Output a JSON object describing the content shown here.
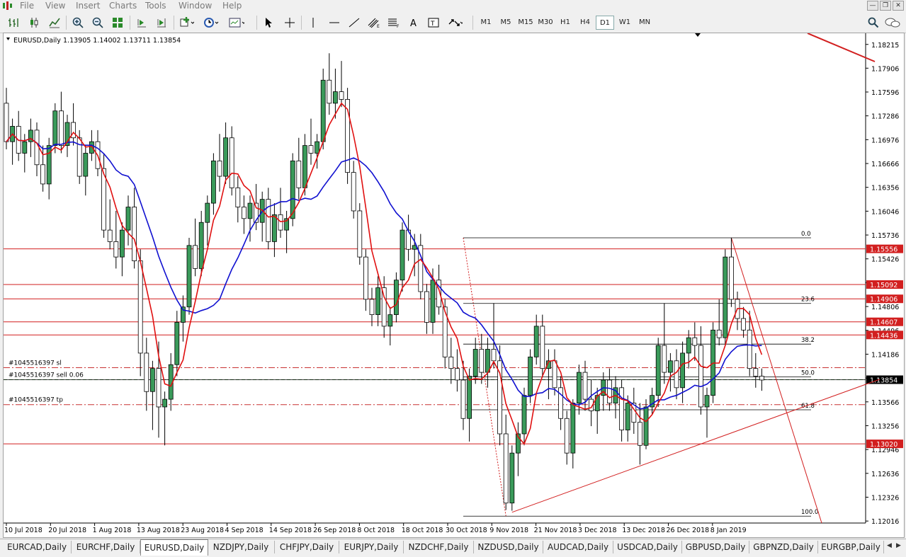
{
  "menu": [
    "File",
    "View",
    "Insert",
    "Charts",
    "Tools",
    "Window",
    "Help"
  ],
  "toolbar": {
    "timeframes": [
      "M1",
      "M5",
      "M15",
      "M30",
      "H1",
      "H4",
      "D1",
      "W1",
      "MN"
    ],
    "active_timeframe": "D1"
  },
  "chart_info": {
    "symbol_label": "EURUSD,Daily",
    "ohlc": "1.13905 1.14002 1.13711 1.13854"
  },
  "price_axis": [
    "1.18215",
    "1.17906",
    "1.17596",
    "1.17286",
    "1.16976",
    "1.16666",
    "1.16356",
    "1.16046",
    "1.15736",
    "1.15426",
    "1.15116",
    "1.14806",
    "1.14496",
    "1.14186",
    "1.13876",
    "1.13566",
    "1.13256",
    "1.12946",
    "1.12636",
    "1.12326",
    "1.12016"
  ],
  "price_range": [
    1.1199,
    1.1836
  ],
  "date_axis": [
    "10 Jul 2018",
    "20 Jul 2018",
    "1 Aug 2018",
    "13 Aug 2018",
    "23 Aug 2018",
    "4 Sep 2018",
    "14 Sep 2018",
    "26 Sep 2018",
    "8 Oct 2018",
    "18 Oct 2018",
    "30 Oct 2018",
    "9 Nov 2018",
    "21 Nov 2018",
    "3 Dec 2018",
    "13 Dec 2018",
    "26 Dec 2018",
    "8 Jan 2019"
  ],
  "levels": [
    {
      "price": 1.15556,
      "label": "1.15556",
      "color": "#d21f1f"
    },
    {
      "price": 1.15092,
      "label": "1.15092",
      "color": "#d21f1f"
    },
    {
      "price": 1.14906,
      "label": "1.14906",
      "color": "#d21f1f"
    },
    {
      "price": 1.14607,
      "label": "1.14607",
      "color": "#d21f1f"
    },
    {
      "price": 1.14436,
      "label": "1.14436",
      "color": "#d21f1f"
    },
    {
      "price": 1.1302,
      "label": "1.13020",
      "color": "#d21f1f"
    }
  ],
  "current_price": {
    "price": 1.13854,
    "label": "1.13854"
  },
  "order_lines": [
    {
      "label": "#1045516397 sl",
      "price": 1.1401,
      "color": "#c83232",
      "style": "dashdot"
    },
    {
      "label": "#1045516397 sell 0.06",
      "price": 1.13854,
      "color": "#2e8b2e",
      "style": "dash"
    },
    {
      "label": "#1045516397 tp",
      "price": 1.1353,
      "color": "#c83232",
      "style": "dashdot"
    }
  ],
  "fibonacci": [
    {
      "label": "0.0",
      "price": 1.157
    },
    {
      "label": "23.6",
      "price": 1.14846
    },
    {
      "label": "38.2",
      "price": 1.14317
    },
    {
      "label": "50.0",
      "price": 1.1389
    },
    {
      "label": "61.8",
      "price": 1.13463
    },
    {
      "label": "100.0",
      "price": 1.1208
    }
  ],
  "colors": {
    "bull": "#3a9a5a",
    "bear": "#ffffff",
    "fast_ma": "#e01010",
    "slow_ma": "#1010d0",
    "trend": "#d21f1f"
  },
  "tabs": [
    "EURCAD,Daily",
    "EURCHF,Daily",
    "EURUSD,Daily",
    "NZDJPY,Daily",
    "CHFJPY,Daily",
    "EURJPY,Daily",
    "NZDCHF,Daily",
    "NZDUSD,Daily",
    "AUDCAD,Daily",
    "USDCAD,Daily",
    "GBPUSD,Daily",
    "GBPNZD,Daily",
    "EURGBP,Daily"
  ],
  "active_tab": "EURUSD,Daily",
  "chart_data": {
    "type": "candlestick",
    "title": "EURUSD,Daily",
    "ylim": [
      1.1199,
      1.1836
    ],
    "series": [
      {
        "name": "price",
        "points": [
          [
            0,
            1.1745,
            1.1765,
            1.1685,
            1.1695
          ],
          [
            1,
            1.1695,
            1.1725,
            1.1665,
            1.1715
          ],
          [
            2,
            1.1715,
            1.1735,
            1.167,
            1.168
          ],
          [
            3,
            1.168,
            1.1705,
            1.1655,
            1.1695
          ],
          [
            4,
            1.1695,
            1.1725,
            1.1675,
            1.171
          ],
          [
            5,
            1.171,
            1.172,
            1.165,
            1.1665
          ],
          [
            6,
            1.1665,
            1.169,
            1.163,
            1.164
          ],
          [
            7,
            1.164,
            1.17,
            1.162,
            1.169
          ],
          [
            8,
            1.169,
            1.1745,
            1.168,
            1.1735
          ],
          [
            9,
            1.1735,
            1.176,
            1.168,
            1.169
          ],
          [
            10,
            1.169,
            1.173,
            1.1675,
            1.172
          ],
          [
            11,
            1.172,
            1.1745,
            1.169,
            1.17
          ],
          [
            12,
            1.17,
            1.171,
            1.164,
            1.165
          ],
          [
            13,
            1.165,
            1.169,
            1.1625,
            1.168
          ],
          [
            14,
            1.168,
            1.171,
            1.167,
            1.1695
          ],
          [
            15,
            1.1695,
            1.171,
            1.165,
            1.166
          ],
          [
            16,
            1.166,
            1.168,
            1.157,
            1.158
          ],
          [
            17,
            1.158,
            1.162,
            1.1555,
            1.1565
          ],
          [
            18,
            1.1565,
            1.1605,
            1.153,
            1.1545
          ],
          [
            19,
            1.1545,
            1.159,
            1.152,
            1.158
          ],
          [
            20,
            1.158,
            1.1625,
            1.156,
            1.161
          ],
          [
            21,
            1.161,
            1.1635,
            1.153,
            1.154
          ],
          [
            22,
            1.154,
            1.1555,
            1.139,
            1.142
          ],
          [
            23,
            1.142,
            1.144,
            1.1345,
            1.137
          ],
          [
            24,
            1.137,
            1.141,
            1.132,
            1.14
          ],
          [
            25,
            1.14,
            1.1435,
            1.131,
            1.135
          ],
          [
            26,
            1.135,
            1.137,
            1.13,
            1.136
          ],
          [
            27,
            1.136,
            1.142,
            1.1345,
            1.1405
          ],
          [
            28,
            1.1405,
            1.1475,
            1.139,
            1.146
          ],
          [
            29,
            1.146,
            1.1495,
            1.1435,
            1.148
          ],
          [
            30,
            1.148,
            1.157,
            1.147,
            1.156
          ],
          [
            31,
            1.156,
            1.1595,
            1.152,
            1.153
          ],
          [
            32,
            1.153,
            1.1605,
            1.152,
            1.159
          ],
          [
            33,
            1.159,
            1.1625,
            1.156,
            1.1615
          ],
          [
            34,
            1.1615,
            1.168,
            1.16,
            1.167
          ],
          [
            35,
            1.167,
            1.1705,
            1.163,
            1.165
          ],
          [
            36,
            1.165,
            1.172,
            1.164,
            1.17
          ],
          [
            37,
            1.17,
            1.1715,
            1.1625,
            1.1635
          ],
          [
            38,
            1.1635,
            1.165,
            1.159,
            1.161
          ],
          [
            39,
            1.161,
            1.1625,
            1.1575,
            1.1595
          ],
          [
            40,
            1.1595,
            1.1625,
            1.1565,
            1.1615
          ],
          [
            41,
            1.1615,
            1.164,
            1.158,
            1.159
          ],
          [
            42,
            1.159,
            1.163,
            1.1565,
            1.162
          ],
          [
            43,
            1.162,
            1.1635,
            1.1555,
            1.1565
          ],
          [
            44,
            1.1565,
            1.1615,
            1.1545,
            1.16
          ],
          [
            45,
            1.16,
            1.1635,
            1.157,
            1.158
          ],
          [
            46,
            1.158,
            1.1605,
            1.155,
            1.1595
          ],
          [
            47,
            1.1595,
            1.168,
            1.1585,
            1.167
          ],
          [
            48,
            1.167,
            1.17,
            1.162,
            1.1635
          ],
          [
            49,
            1.1635,
            1.1705,
            1.1625,
            1.169
          ],
          [
            50,
            1.169,
            1.1725,
            1.1665,
            1.168
          ],
          [
            51,
            1.168,
            1.1705,
            1.166,
            1.1695
          ],
          [
            52,
            1.1695,
            1.179,
            1.1685,
            1.1775
          ],
          [
            53,
            1.1775,
            1.181,
            1.173,
            1.1745
          ],
          [
            54,
            1.1745,
            1.179,
            1.1725,
            1.176
          ],
          [
            55,
            1.176,
            1.18,
            1.174,
            1.175
          ],
          [
            56,
            1.175,
            1.1765,
            1.164,
            1.1655
          ],
          [
            57,
            1.1655,
            1.167,
            1.1595,
            1.1605
          ],
          [
            58,
            1.1605,
            1.1615,
            1.1535,
            1.1545
          ],
          [
            59,
            1.1545,
            1.1555,
            1.1475,
            1.149
          ],
          [
            60,
            1.149,
            1.1505,
            1.1455,
            1.147
          ],
          [
            61,
            1.147,
            1.152,
            1.1455,
            1.1505
          ],
          [
            62,
            1.1505,
            1.152,
            1.144,
            1.1455
          ],
          [
            63,
            1.1455,
            1.148,
            1.143,
            1.147
          ],
          [
            64,
            1.147,
            1.1525,
            1.146,
            1.1515
          ],
          [
            65,
            1.1515,
            1.159,
            1.15,
            1.158
          ],
          [
            66,
            1.158,
            1.16,
            1.154,
            1.1555
          ],
          [
            67,
            1.1555,
            1.1575,
            1.152,
            1.156
          ],
          [
            68,
            1.156,
            1.1575,
            1.149,
            1.15
          ],
          [
            69,
            1.15,
            1.151,
            1.1445,
            1.146
          ],
          [
            70,
            1.146,
            1.153,
            1.1445,
            1.1515
          ],
          [
            71,
            1.1515,
            1.1535,
            1.147,
            1.148
          ],
          [
            72,
            1.148,
            1.149,
            1.14,
            1.1415
          ],
          [
            73,
            1.1415,
            1.144,
            1.138,
            1.14
          ],
          [
            74,
            1.14,
            1.1425,
            1.137,
            1.1385
          ],
          [
            75,
            1.1385,
            1.141,
            1.132,
            1.1335
          ],
          [
            76,
            1.1335,
            1.14,
            1.1305,
            1.139
          ],
          [
            77,
            1.139,
            1.144,
            1.138,
            1.1425
          ],
          [
            78,
            1.1425,
            1.1445,
            1.138,
            1.1395
          ],
          [
            79,
            1.1395,
            1.144,
            1.1375,
            1.1425
          ],
          [
            80,
            1.1425,
            1.1485,
            1.14,
            1.141
          ],
          [
            81,
            1.141,
            1.143,
            1.13,
            1.1315
          ],
          [
            82,
            1.1315,
            1.134,
            1.1216,
            1.1225
          ],
          [
            83,
            1.1225,
            1.13,
            1.1215,
            1.129
          ],
          [
            84,
            1.129,
            1.133,
            1.126,
            1.1315
          ],
          [
            85,
            1.1315,
            1.1375,
            1.13,
            1.1365
          ],
          [
            86,
            1.1365,
            1.1425,
            1.1355,
            1.1415
          ],
          [
            87,
            1.1415,
            1.147,
            1.1405,
            1.1455
          ],
          [
            88,
            1.1455,
            1.147,
            1.139,
            1.14
          ],
          [
            89,
            1.14,
            1.1425,
            1.136,
            1.141
          ],
          [
            90,
            1.141,
            1.1425,
            1.1365,
            1.1375
          ],
          [
            91,
            1.1375,
            1.139,
            1.132,
            1.1335
          ],
          [
            92,
            1.1335,
            1.1345,
            1.1275,
            1.129
          ],
          [
            93,
            1.129,
            1.136,
            1.127,
            1.1355
          ],
          [
            94,
            1.1355,
            1.1405,
            1.134,
            1.1395
          ],
          [
            95,
            1.1395,
            1.141,
            1.1345,
            1.136
          ],
          [
            96,
            1.136,
            1.1385,
            1.1325,
            1.1345
          ],
          [
            97,
            1.1345,
            1.1375,
            1.1315,
            1.1365
          ],
          [
            98,
            1.1365,
            1.1395,
            1.1345,
            1.1385
          ],
          [
            99,
            1.1385,
            1.14,
            1.1345,
            1.1355
          ],
          [
            100,
            1.1355,
            1.139,
            1.1335,
            1.1375
          ],
          [
            101,
            1.1375,
            1.1385,
            1.1305,
            1.132
          ],
          [
            102,
            1.132,
            1.1365,
            1.1305,
            1.1355
          ],
          [
            103,
            1.1355,
            1.1375,
            1.1315,
            1.133
          ],
          [
            104,
            1.133,
            1.1355,
            1.1275,
            1.13
          ],
          [
            105,
            1.13,
            1.136,
            1.1295,
            1.135
          ],
          [
            106,
            1.135,
            1.1375,
            1.134,
            1.1365
          ],
          [
            107,
            1.1365,
            1.144,
            1.135,
            1.143
          ],
          [
            108,
            1.143,
            1.1485,
            1.138,
            1.1395
          ],
          [
            109,
            1.1395,
            1.142,
            1.137,
            1.141
          ],
          [
            110,
            1.141,
            1.1425,
            1.136,
            1.1375
          ],
          [
            111,
            1.1375,
            1.1435,
            1.1355,
            1.142
          ],
          [
            112,
            1.142,
            1.145,
            1.14,
            1.144
          ],
          [
            113,
            1.144,
            1.146,
            1.141,
            1.143
          ],
          [
            114,
            1.143,
            1.1455,
            1.134,
            1.135
          ],
          [
            115,
            1.135,
            1.1375,
            1.131,
            1.1365
          ],
          [
            116,
            1.1365,
            1.146,
            1.1355,
            1.145
          ],
          [
            117,
            1.145,
            1.149,
            1.143,
            1.144
          ],
          [
            118,
            1.144,
            1.1555,
            1.143,
            1.1545
          ],
          [
            119,
            1.1545,
            1.157,
            1.148,
            1.149
          ],
          [
            120,
            1.149,
            1.15,
            1.145,
            1.1465
          ],
          [
            121,
            1.1465,
            1.148,
            1.144,
            1.145
          ],
          [
            122,
            1.145,
            1.1475,
            1.139,
            1.14
          ],
          [
            123,
            1.14,
            1.142,
            1.1375,
            1.139
          ],
          [
            124,
            1.139,
            1.14,
            1.1371,
            1.1385
          ]
        ]
      }
    ]
  }
}
